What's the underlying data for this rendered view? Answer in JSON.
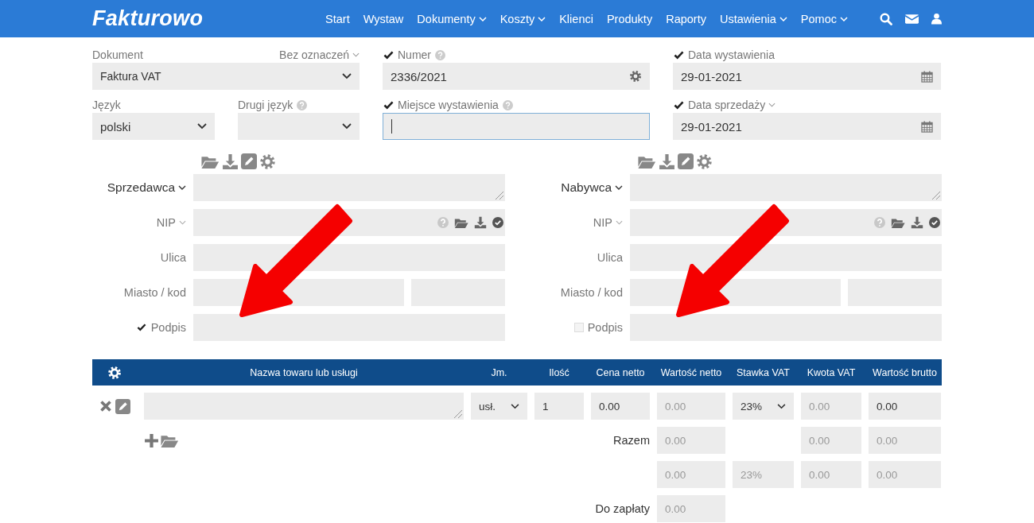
{
  "navbar": {
    "logo": "Fakturowo",
    "items": [
      {
        "label": "Start",
        "dropdown": false
      },
      {
        "label": "Wystaw",
        "dropdown": false
      },
      {
        "label": "Dokumenty",
        "dropdown": true
      },
      {
        "label": "Koszty",
        "dropdown": true
      },
      {
        "label": "Klienci",
        "dropdown": false
      },
      {
        "label": "Produkty",
        "dropdown": false
      },
      {
        "label": "Raporty",
        "dropdown": false
      },
      {
        "label": "Ustawienia",
        "dropdown": true
      },
      {
        "label": "Pomoc",
        "dropdown": true
      }
    ]
  },
  "document": {
    "label": "Dokument",
    "marking": "Bez oznaczeń",
    "value": "Faktura VAT"
  },
  "language": {
    "label": "Język",
    "value": "polski"
  },
  "second_language": {
    "label": "Drugi język"
  },
  "number": {
    "label": "Numer",
    "checked": true,
    "value": "2336/2021"
  },
  "place": {
    "label": "Miejsce wystawienia",
    "checked": true,
    "focused": true
  },
  "issue_date": {
    "label": "Data wystawienia",
    "checked": true,
    "value": "29-01-2021"
  },
  "sale_date": {
    "label": "Data sprzedaży",
    "checked": true,
    "value": "29-01-2021"
  },
  "parties": [
    {
      "title": "Sprzedawca",
      "nip_label": "NIP",
      "street_label": "Ulica",
      "city_label": "Miasto / kod",
      "signature_label": "Podpis",
      "signature_checked": true
    },
    {
      "title": "Nabywca",
      "nip_label": "NIP",
      "street_label": "Ulica",
      "city_label": "Miasto / kod",
      "signature_label": "Podpis",
      "signature_checked": false
    }
  ],
  "items_table": {
    "columns": [
      "Nazwa towaru lub usługi",
      "Jm.",
      "Ilość",
      "Cena netto",
      "Wartość netto",
      "Stawka VAT",
      "Kwota VAT",
      "Wartość brutto"
    ],
    "rows": [
      {
        "cells": [
          {
            "kind": "textarea"
          },
          {
            "kind": "select",
            "value": "usł."
          },
          {
            "kind": "input",
            "value": "1"
          },
          {
            "kind": "input",
            "value": "0.00"
          },
          {
            "kind": "readonly",
            "value": "0.00"
          },
          {
            "kind": "select",
            "value": "23%"
          },
          {
            "kind": "readonly",
            "value": "0.00"
          },
          {
            "kind": "input",
            "value": "0.00"
          }
        ]
      }
    ]
  },
  "summary": [
    {
      "label": "Razem",
      "net_value": "0.00",
      "vat_amount": "0.00",
      "gross_value": "0.00"
    },
    {
      "net_value": "0.00",
      "vat_rate": "23%",
      "vat_amount": "0.00",
      "gross_value": "0.00"
    },
    {
      "label": "Do zapłaty",
      "net_value": "0.00"
    }
  ]
}
